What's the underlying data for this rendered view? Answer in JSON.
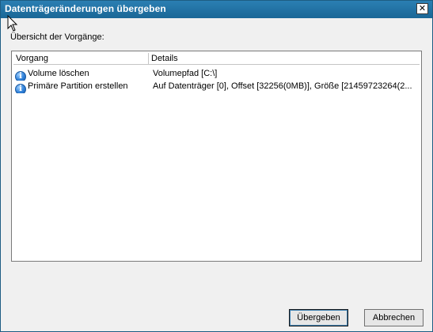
{
  "window": {
    "title": "Datenträgeränderungen übergeben",
    "close_glyph": "✕"
  },
  "overview_label": "Übersicht der Vorgänge:",
  "table": {
    "columns": [
      "Vorgang",
      "Details"
    ],
    "rows": [
      {
        "icon": "info-icon",
        "operation": "Volume löschen",
        "details": "Volumepfad [C:\\]"
      },
      {
        "icon": "info-icon",
        "operation": "Primäre Partition erstellen",
        "details": "Auf Datenträger [0], Offset [32256(0MB)], Größe [21459723264(2..."
      }
    ]
  },
  "buttons": {
    "submit": "Übergeben",
    "cancel": "Abbrechen"
  },
  "colors": {
    "titlebar": "#1f6fa0",
    "info_icon": "#2f80d8"
  }
}
